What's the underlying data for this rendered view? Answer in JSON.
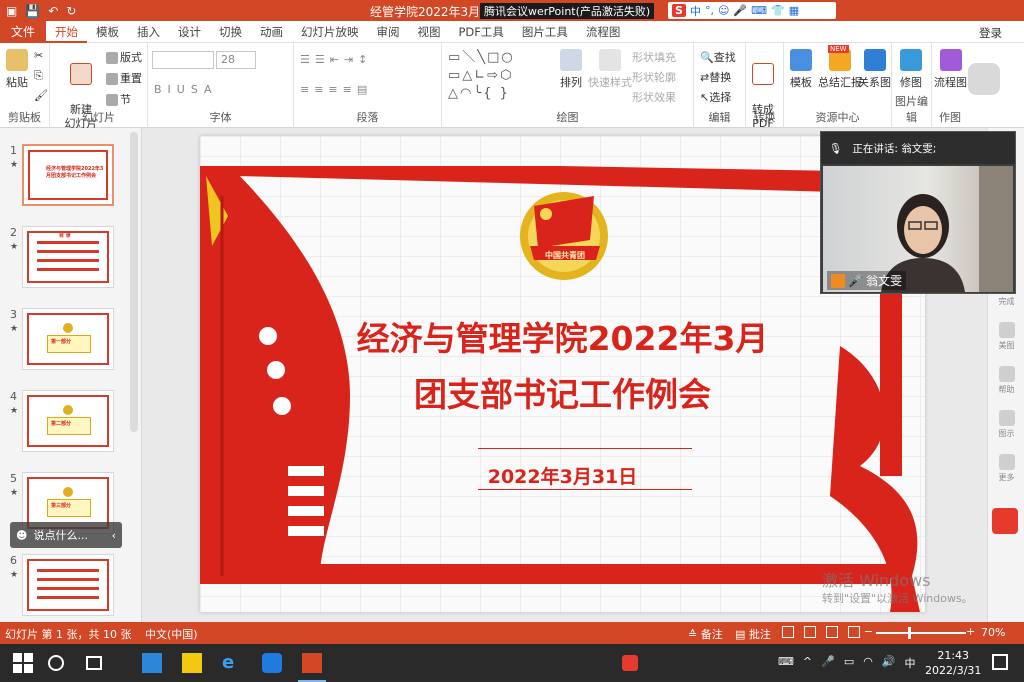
{
  "titlebar": {
    "title": "经管学院2022年3月团支",
    "meeting": "腾讯会议",
    "app_suffix": "werPoint(产品激活失败)",
    "ime": {
      "logo": "S",
      "mode": "中",
      "punct": "°,"
    }
  },
  "menubar": {
    "file": "文件",
    "tabs": [
      "开始",
      "模板",
      "插入",
      "设计",
      "切换",
      "动画",
      "幻灯片放映",
      "审阅",
      "视图",
      "PDF工具",
      "图片工具",
      "流程图"
    ],
    "active_tab": "开始",
    "login": "登录"
  },
  "ribbon": {
    "groups": {
      "clipboard": "剪贴板",
      "slides": "幻灯片",
      "font": "字体",
      "paragraph": "段落",
      "drawing": "绘图",
      "editing": "编辑",
      "convert": "转换",
      "resources": "资源中心",
      "picedit": "图片编辑",
      "artwork": "作图"
    },
    "paste": "粘贴",
    "new_slide": "新建\n幻灯片",
    "layout": "版式",
    "reset": "重置",
    "section": "节",
    "font_size": "28",
    "arrange": "排列",
    "quick_style": "快速样式",
    "shape_fill": "形状填充",
    "shape_outline": "形状轮廓",
    "shape_effect": "形状效果",
    "find": "查找",
    "replace": "替换",
    "select": "选择",
    "to_pdf": "转成\nPDF",
    "template": "模板",
    "report": "总结汇报",
    "relation": "关系图",
    "retouch": "修图",
    "flowchart": "流程图",
    "new_badge": "NEW"
  },
  "slides": [
    {
      "num": "1",
      "star": "★",
      "text": "经济与管理学院2022年3月团支部书记工作例会"
    },
    {
      "num": "2",
      "star": "★",
      "text": "目 录"
    },
    {
      "num": "3",
      "star": "★",
      "text": "第一部分"
    },
    {
      "num": "4",
      "star": "★",
      "text": "第二部分"
    },
    {
      "num": "5",
      "star": "★",
      "text": "第三部分"
    },
    {
      "num": "6",
      "star": "★",
      "text": ""
    }
  ],
  "chat": {
    "placeholder": "说点什么..."
  },
  "slide": {
    "title_line1": "经济与管理学院2022年3月",
    "title_line2": "团支部书记工作例会",
    "date": "2022年3月31日",
    "emblem_text": "中国共青团"
  },
  "video": {
    "speaking": "正在讲话: 翁文雯;",
    "name": "翁文雯"
  },
  "rightpanel": [
    "完成",
    "美图",
    "帮助",
    "图示",
    "更多"
  ],
  "watermark": {
    "line1": "激活 Windows",
    "line2": "转到\"设置\"以激活 Windows。"
  },
  "statusbar": {
    "slide_info": "幻灯片 第 1 张，共 10 张",
    "language": "中文(中国)",
    "notes": "备注",
    "comments": "批注",
    "zoom": "70%"
  },
  "taskbar": {
    "time": "21:43",
    "date": "2022/3/31",
    "tray_lang": "中"
  },
  "colors": {
    "accent": "#d24726",
    "slide_red": "#d9241b",
    "gold": "#e0b020"
  }
}
